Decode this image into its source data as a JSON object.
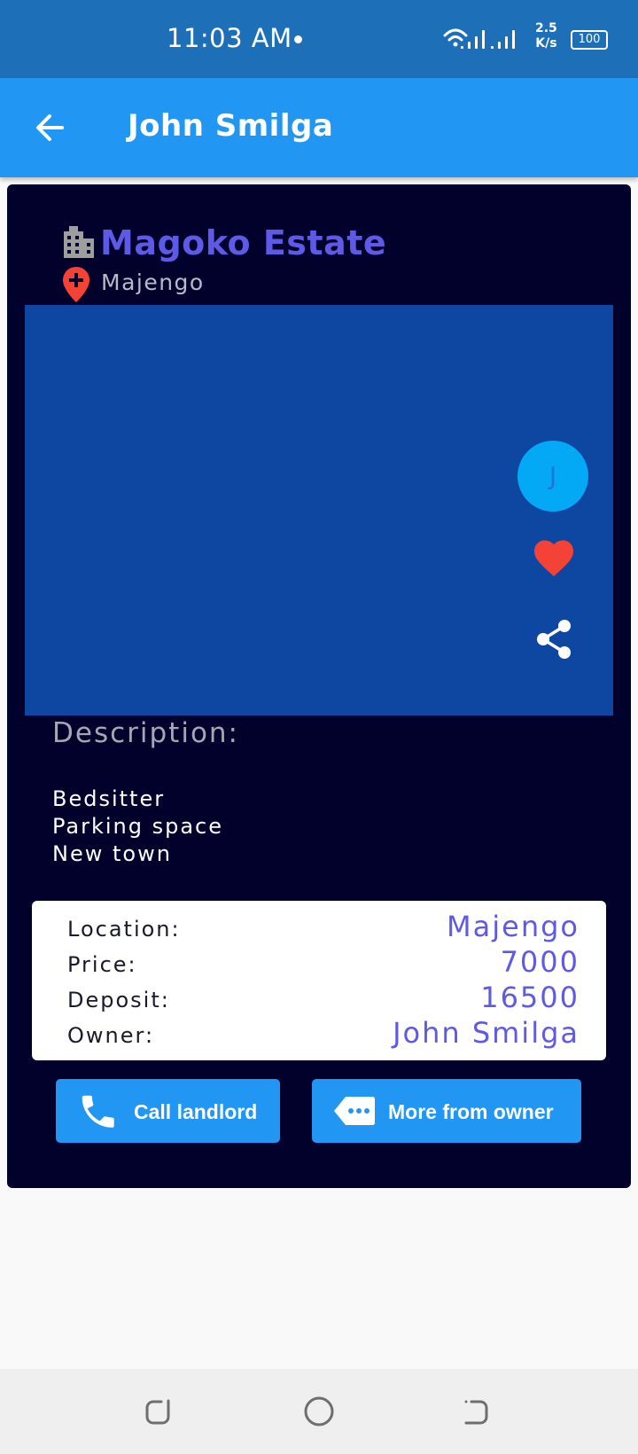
{
  "status_bar": {
    "time": "11:03 AM",
    "net_speed_value": "2.5",
    "net_speed_unit": "K/s",
    "battery": "100",
    "icons": [
      "wifi-icon",
      "signal-icon",
      "signal-icon",
      "battery-icon"
    ]
  },
  "app_bar": {
    "title": "John Smilga",
    "back_icon": "arrow-back-icon",
    "color": "#2196f3"
  },
  "listing": {
    "name": "Magoko Estate",
    "location": "Majengo",
    "avatar_letter": "J",
    "description_title": "Description:",
    "description_lines": [
      "Bedsitter",
      "Parking space",
      "New town"
    ],
    "details": [
      {
        "label": "Location:",
        "value": "Majengo"
      },
      {
        "label": "Price:",
        "value": "7000"
      },
      {
        "label": "Deposit:",
        "value": "16500"
      },
      {
        "label": "Owner:",
        "value": "John Smilga"
      }
    ]
  },
  "actions": {
    "call_label": "Call landlord",
    "more_label": "More from owner"
  },
  "colors": {
    "card_bg": "#02012c",
    "image_bg": "#0d47a1",
    "accent": "#5f5ae6",
    "heart": "#f44336",
    "avatar": "#03a9f4"
  },
  "nav_bar": {
    "icons": [
      "recent-apps-icon",
      "home-icon",
      "back-icon"
    ]
  }
}
